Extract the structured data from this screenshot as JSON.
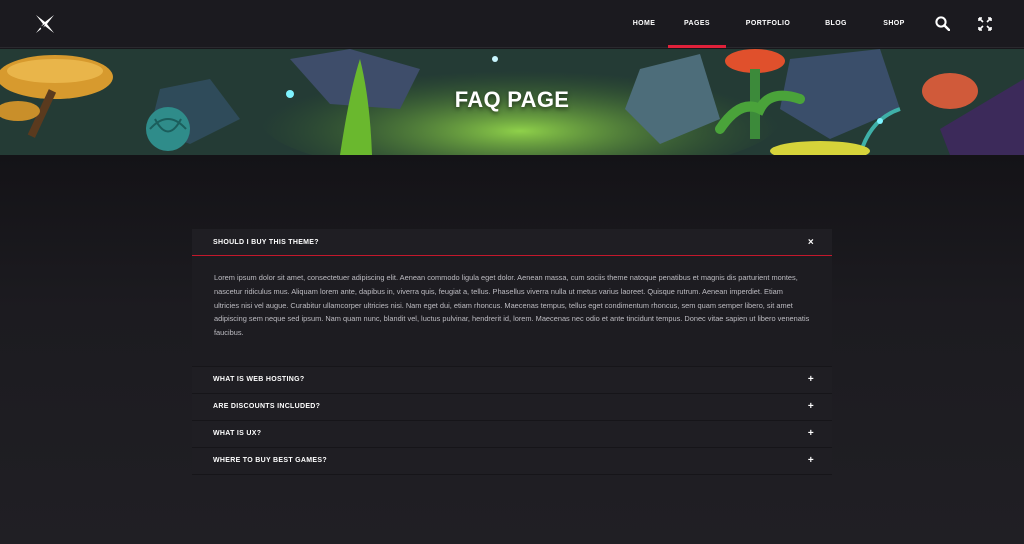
{
  "nav": {
    "items": [
      {
        "label": "HOME",
        "active": false
      },
      {
        "label": "PAGES",
        "active": true
      },
      {
        "label": "PORTFOLIO",
        "active": false
      },
      {
        "label": "BLOG",
        "active": false
      },
      {
        "label": "SHOP",
        "active": false
      }
    ],
    "accent_color": "#e0213a",
    "icons": [
      "logo-icon",
      "search-icon",
      "expand-icon"
    ]
  },
  "banner": {
    "title": "FAQ PAGE"
  },
  "faq": {
    "items": [
      {
        "question": "SHOULD I BUY THIS THEME?",
        "toggle": "×",
        "open": true,
        "answer": "Lorem ipsum dolor sit amet, consectetuer adipiscing elit. Aenean commodo ligula eget dolor. Aenean massa, cum sociis theme natoque penatibus et magnis dis parturient montes, nascetur ridiculus mus. Aliquam lorem ante, dapibus in, viverra quis, feugiat a, tellus. Phasellus viverra nulla ut metus varius laoreet. Quisque rutrum. Aenean imperdiet. Etiam ultricies nisi vel augue. Curabitur ullamcorper ultricies nisi. Nam eget dui, etiam rhoncus. Maecenas tempus, tellus eget condimentum rhoncus, sem quam semper libero, sit amet adipiscing sem neque sed ipsum. Nam quam nunc, blandit vel, luctus pulvinar, hendrerit id, lorem. Maecenas nec odio et ante tincidunt tempus. Donec vitae sapien ut libero venenatis faucibus."
      },
      {
        "question": "WHAT IS WEB HOSTING?",
        "toggle": "+",
        "open": false
      },
      {
        "question": "ARE DISCOUNTS INCLUDED?",
        "toggle": "+",
        "open": false
      },
      {
        "question": "WHAT IS UX?",
        "toggle": "+",
        "open": false
      },
      {
        "question": "WHERE TO BUY BEST GAMES?",
        "toggle": "+",
        "open": false
      }
    ]
  }
}
